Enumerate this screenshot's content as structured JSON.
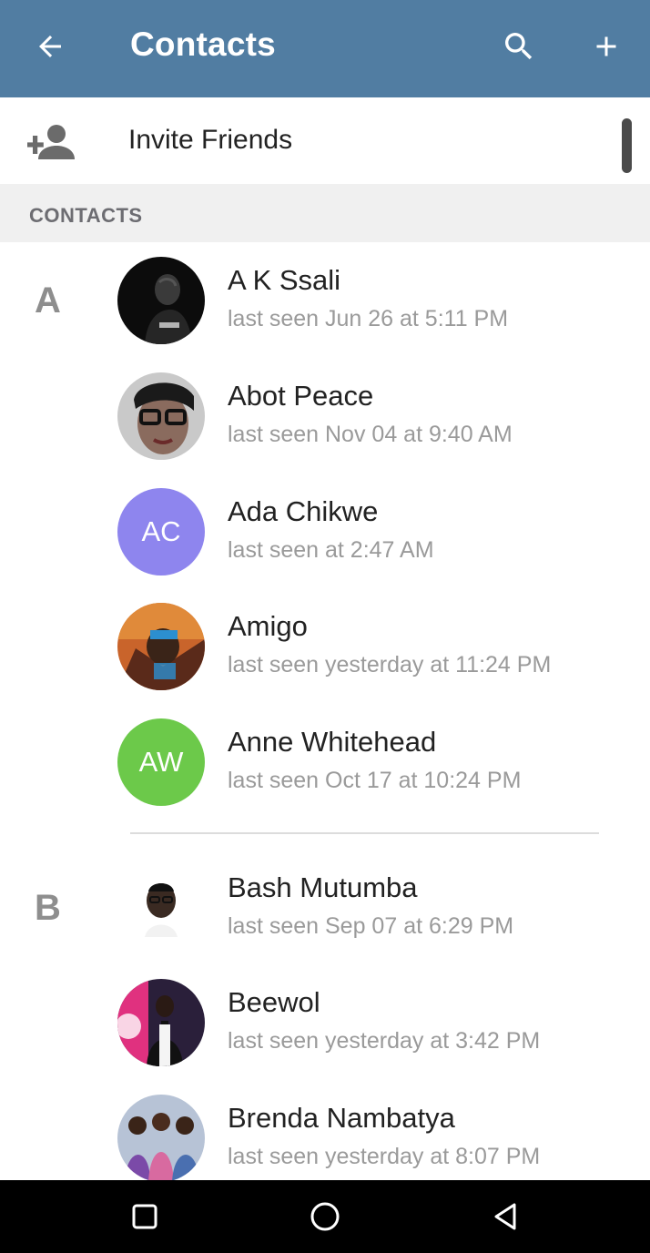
{
  "appbar": {
    "title": "Contacts",
    "back_icon": "arrow-left-icon",
    "search_icon": "search-icon",
    "add_icon": "plus-icon",
    "background_color": "#517da2"
  },
  "invite": {
    "icon": "person-add-icon",
    "label": "Invite Friends"
  },
  "section": {
    "label": "CONTACTS"
  },
  "groups": [
    {
      "letter": "A",
      "contacts": [
        {
          "name": "A K Ssali",
          "status": "last seen Jun 26 at 5:11 PM",
          "avatar": {
            "type": "photo"
          }
        },
        {
          "name": "Abot Peace",
          "status": "last seen Nov 04 at 9:40 AM",
          "avatar": {
            "type": "photo"
          }
        },
        {
          "name": "Ada Chikwe",
          "status": "last seen at 2:47 AM",
          "avatar": {
            "type": "initials",
            "initials": "AC",
            "color": "#8e85ee"
          }
        },
        {
          "name": "Amigo",
          "status": "last seen yesterday at 11:24 PM",
          "avatar": {
            "type": "photo"
          }
        },
        {
          "name": "Anne Whitehead",
          "status": "last seen Oct 17 at 10:24 PM",
          "avatar": {
            "type": "initials",
            "initials": "AW",
            "color": "#6cc94a"
          }
        }
      ]
    },
    {
      "letter": "B",
      "contacts": [
        {
          "name": "Bash Mutumba",
          "status": "last seen Sep 07 at 6:29 PM",
          "avatar": {
            "type": "photo"
          }
        },
        {
          "name": "Beewol",
          "status": "last seen yesterday at 3:42 PM",
          "avatar": {
            "type": "photo"
          }
        },
        {
          "name": "Brenda Nambatya",
          "status": "last seen yesterday at 8:07 PM",
          "avatar": {
            "type": "photo"
          }
        }
      ]
    }
  ],
  "navbar": {
    "recents_icon": "square-icon",
    "home_icon": "circle-icon",
    "back_icon": "triangle-back-icon"
  }
}
